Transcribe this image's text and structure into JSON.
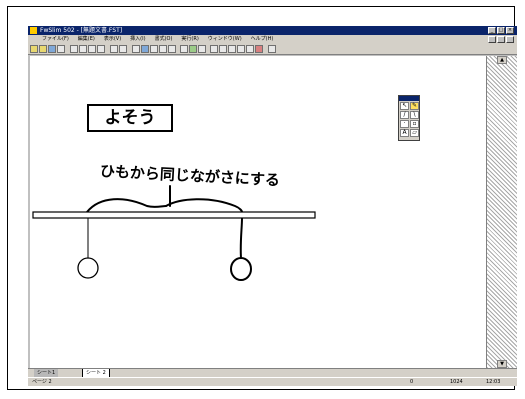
{
  "window": {
    "title": "FwSlim 502 - [無題文書.FST]",
    "controls": [
      "_",
      "□",
      "×"
    ]
  },
  "menu": {
    "items": [
      "ファイル(F)",
      "編集(E)",
      "表示(V)",
      "挿入(I)",
      "書式(O)",
      "実行(R)",
      "ウィンドウ(W)",
      "ヘルプ(H)"
    ]
  },
  "canvas": {
    "greeting_label": "よそう",
    "handwritten_note": "ひもから同じながさにする"
  },
  "tabs": [
    {
      "label": "シート1"
    },
    {
      "label": "シート 2"
    }
  ],
  "status": {
    "left": "ページ 2",
    "mid": "0",
    "num": "1024",
    "time": "12:03"
  },
  "icons": {
    "palette": [
      "cursor-icon",
      "pencil-icon",
      "line-icon",
      "eraser-icon",
      "text-icon"
    ]
  }
}
